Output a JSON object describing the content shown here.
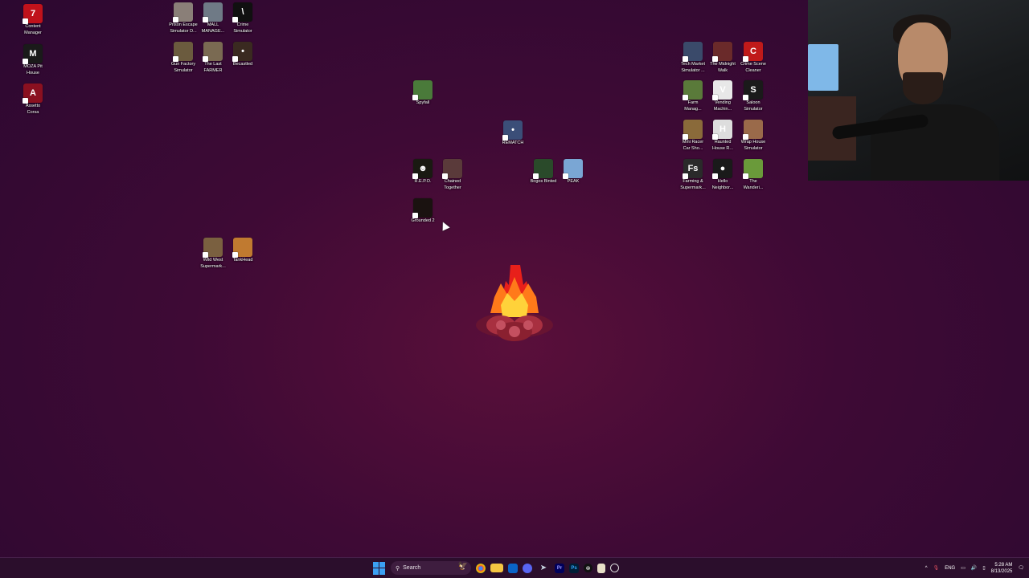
{
  "desktop_icons": [
    {
      "label": "Content\nManager",
      "color": "#c0121b",
      "glyph": "7"
    },
    {
      "label": "MOZA Pit\nHouse",
      "color": "#1a1a1a",
      "glyph": "M"
    },
    {
      "label": "Assetto\nCorsa",
      "color": "#8a1020",
      "glyph": "A"
    },
    {
      "label": "Prison Escape\nSimulator D...",
      "color": "#8a7f78",
      "glyph": ""
    },
    {
      "label": "MALL\nMANAGE...",
      "color": "#6f7a86",
      "glyph": ""
    },
    {
      "label": "Crime\nSimulator",
      "color": "#101010",
      "glyph": "\\"
    },
    {
      "label": "Gun Factory\nSimulator",
      "color": "#6b5b3e",
      "glyph": ""
    },
    {
      "label": "The Last\nFARMER",
      "color": "#7a6a52",
      "glyph": ""
    },
    {
      "label": "Becastled",
      "color": "#3a2a20",
      "glyph": "•"
    },
    {
      "label": "Spyfall",
      "color": "#4a7a3a",
      "glyph": ""
    },
    {
      "label": "REMATCH",
      "color": "#3b4e78",
      "glyph": "•"
    },
    {
      "label": "R.E.P.O.",
      "color": "#1a1a12",
      "glyph": "☻"
    },
    {
      "label": "Chained\nTogether",
      "color": "#5a3a3a",
      "glyph": ""
    },
    {
      "label": "Bogos Binted",
      "color": "#2a4a2a",
      "glyph": ""
    },
    {
      "label": "PEAK",
      "color": "#7aa6d4",
      "glyph": ""
    },
    {
      "label": "Grounded 2",
      "color": "#1a1210",
      "glyph": ""
    },
    {
      "label": "Wild West\nSupermark...",
      "color": "#7a6040",
      "glyph": ""
    },
    {
      "label": "TankHead",
      "color": "#c07a30",
      "glyph": ""
    },
    {
      "label": "Tech Market\nSimulator ...",
      "color": "#3a4a6a",
      "glyph": ""
    },
    {
      "label": "The Midnight\nWalk",
      "color": "#6a2a2a",
      "glyph": ""
    },
    {
      "label": "Crime Scene\nCleaner",
      "color": "#c01a1a",
      "glyph": "C"
    },
    {
      "label": "Farm\nManag...",
      "color": "#5a7a3a",
      "glyph": ""
    },
    {
      "label": "Vending\nMachin...",
      "color": "#e8e8e8",
      "glyph": "V"
    },
    {
      "label": "Saloon\nSimulator",
      "color": "#1a1a1a",
      "glyph": "S"
    },
    {
      "label": "Mini Racer\nCar Sho...",
      "color": "#8a6a3a",
      "glyph": ""
    },
    {
      "label": "Haunted\nHouse R...",
      "color": "#ddd",
      "glyph": "H"
    },
    {
      "label": "Wrap House\nSimulator",
      "color": "#9a6a4a",
      "glyph": ""
    },
    {
      "label": "Farming &\nSupermark...",
      "color": "#2a2a2a",
      "glyph": "Fs"
    },
    {
      "label": "Hello\nNeighbor...",
      "color": "#1a1a1a",
      "glyph": "●"
    },
    {
      "label": "The\nWanderi...",
      "color": "#6a9a3a",
      "glyph": ""
    }
  ],
  "taskbar": {
    "search_label": "Search",
    "apps": [
      "chrome-icon",
      "file-explorer-icon",
      "outlook-icon",
      "discord-icon",
      "steam-icon",
      "premiere-icon",
      "photoshop-icon",
      "capcut-icon",
      "notepad-icon",
      "obs-icon"
    ],
    "premiere_label": "Pr",
    "photoshop_label": "Ps",
    "lang": "ENG",
    "time": "5:28 AM",
    "date": "8/13/2025"
  }
}
